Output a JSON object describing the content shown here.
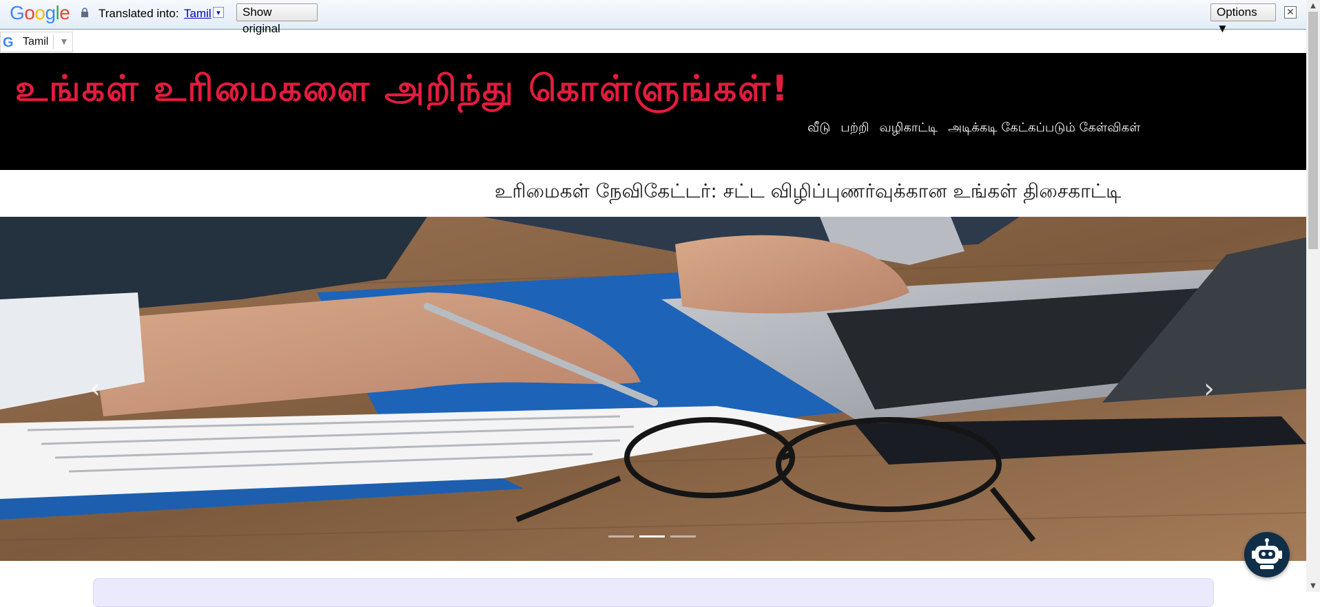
{
  "translate_bar": {
    "logo_text": "Google",
    "translated_into_label": "Translated into:",
    "language": "Tamil",
    "language_arrow": "▾",
    "show_original_label": "Show original",
    "options_label": "Options ▼",
    "close_glyph": "✕"
  },
  "language_selector": {
    "logo": "G",
    "selected": "Tamil",
    "arrow": "▼"
  },
  "header": {
    "title": "உங்கள் உரிமைகளை அறிந்து கொள்ளுங்கள்!",
    "nav": [
      "வீடு",
      "பற்றி",
      "வழிகாட்டி",
      "அடிக்கடி கேட்கப்படும் கேள்விகள்"
    ],
    "title_color": "#e31c3d",
    "background": "#000000"
  },
  "subtitle": "உரிமைகள் நேவிகேட்டர்: சட்ட விழிப்புணர்வுக்கான உங்கள் திசைகாட்டி",
  "carousel": {
    "image": "person-signing-document-with-laptop",
    "prev_glyph": "‹",
    "next_glyph": "›",
    "indicators": [
      false,
      true,
      false
    ]
  },
  "chatbot": {
    "icon": "robot-icon"
  }
}
